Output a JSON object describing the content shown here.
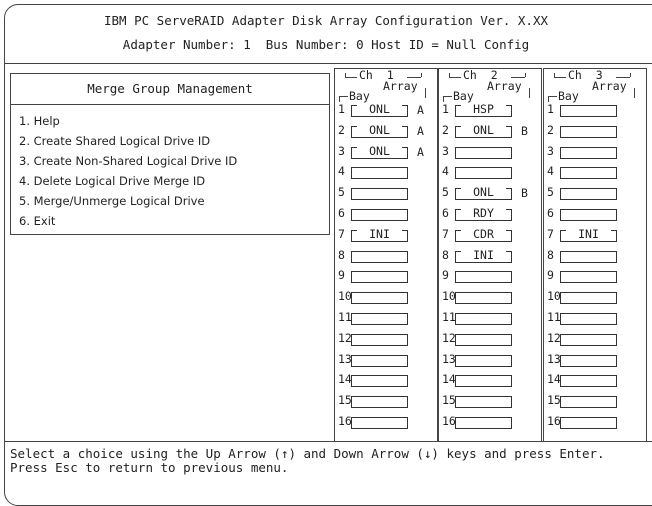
{
  "header": {
    "line1": "IBM PC ServeRAID Adapter Disk Array Configuration Ver. X.XX",
    "line2": "Adapter Number: 1  Bus Number: 0 Host ID = Null Config"
  },
  "menu": {
    "title": "Merge Group Management",
    "items": [
      {
        "label": "1. Help"
      },
      {
        "label": "2. Create Shared Logical Drive ID"
      },
      {
        "label": "3. Create Non-Shared Logical Drive ID"
      },
      {
        "label": "4. Delete Logical Drive Merge ID"
      },
      {
        "label": "5. Merge/Unmerge Logical Drive"
      },
      {
        "label": "6. Exit"
      }
    ]
  },
  "channels": [
    {
      "label": "Ch  1",
      "array_label": "Array",
      "bay_label": "Bay",
      "bays": [
        {
          "num": "1",
          "state": "ONL",
          "array": "A"
        },
        {
          "num": "2",
          "state": "ONL",
          "array": "A"
        },
        {
          "num": "3",
          "state": "ONL",
          "array": "A"
        },
        {
          "num": "4",
          "state": "",
          "array": ""
        },
        {
          "num": "5",
          "state": "",
          "array": ""
        },
        {
          "num": "6",
          "state": "",
          "array": ""
        },
        {
          "num": "7",
          "state": "INI",
          "array": ""
        },
        {
          "num": "8",
          "state": "",
          "array": ""
        },
        {
          "num": "9",
          "state": "",
          "array": ""
        },
        {
          "num": "10",
          "state": "",
          "array": ""
        },
        {
          "num": "11",
          "state": "",
          "array": ""
        },
        {
          "num": "12",
          "state": "",
          "array": ""
        },
        {
          "num": "13",
          "state": "",
          "array": ""
        },
        {
          "num": "14",
          "state": "",
          "array": ""
        },
        {
          "num": "15",
          "state": "",
          "array": ""
        },
        {
          "num": "16",
          "state": "",
          "array": ""
        }
      ]
    },
    {
      "label": "Ch  2",
      "array_label": "Array",
      "bay_label": "Bay",
      "bays": [
        {
          "num": "1",
          "state": "HSP",
          "array": ""
        },
        {
          "num": "2",
          "state": "ONL",
          "array": "B"
        },
        {
          "num": "3",
          "state": "",
          "array": ""
        },
        {
          "num": "4",
          "state": "",
          "array": ""
        },
        {
          "num": "5",
          "state": "ONL",
          "array": "B"
        },
        {
          "num": "6",
          "state": "RDY",
          "array": ""
        },
        {
          "num": "7",
          "state": "CDR",
          "array": ""
        },
        {
          "num": "8",
          "state": "INI",
          "array": ""
        },
        {
          "num": "9",
          "state": "",
          "array": ""
        },
        {
          "num": "10",
          "state": "",
          "array": ""
        },
        {
          "num": "11",
          "state": "",
          "array": ""
        },
        {
          "num": "12",
          "state": "",
          "array": ""
        },
        {
          "num": "13",
          "state": "",
          "array": ""
        },
        {
          "num": "14",
          "state": "",
          "array": ""
        },
        {
          "num": "15",
          "state": "",
          "array": ""
        },
        {
          "num": "16",
          "state": "",
          "array": ""
        }
      ]
    },
    {
      "label": "Ch  3",
      "array_label": "Array",
      "bay_label": "Bay",
      "bays": [
        {
          "num": "1",
          "state": "",
          "array": ""
        },
        {
          "num": "2",
          "state": "",
          "array": ""
        },
        {
          "num": "3",
          "state": "",
          "array": ""
        },
        {
          "num": "4",
          "state": "",
          "array": ""
        },
        {
          "num": "5",
          "state": "",
          "array": ""
        },
        {
          "num": "6",
          "state": "",
          "array": ""
        },
        {
          "num": "7",
          "state": "INI",
          "array": ""
        },
        {
          "num": "8",
          "state": "",
          "array": ""
        },
        {
          "num": "9",
          "state": "",
          "array": ""
        },
        {
          "num": "10",
          "state": "",
          "array": ""
        },
        {
          "num": "11",
          "state": "",
          "array": ""
        },
        {
          "num": "12",
          "state": "",
          "array": ""
        },
        {
          "num": "13",
          "state": "",
          "array": ""
        },
        {
          "num": "14",
          "state": "",
          "array": ""
        },
        {
          "num": "15",
          "state": "",
          "array": ""
        },
        {
          "num": "16",
          "state": "",
          "array": ""
        }
      ]
    }
  ],
  "status": {
    "line1": "Select a choice using the Up Arrow (↑) and Down Arrow (↓) keys and press Enter.",
    "line2": "Press Esc to return to previous menu."
  }
}
